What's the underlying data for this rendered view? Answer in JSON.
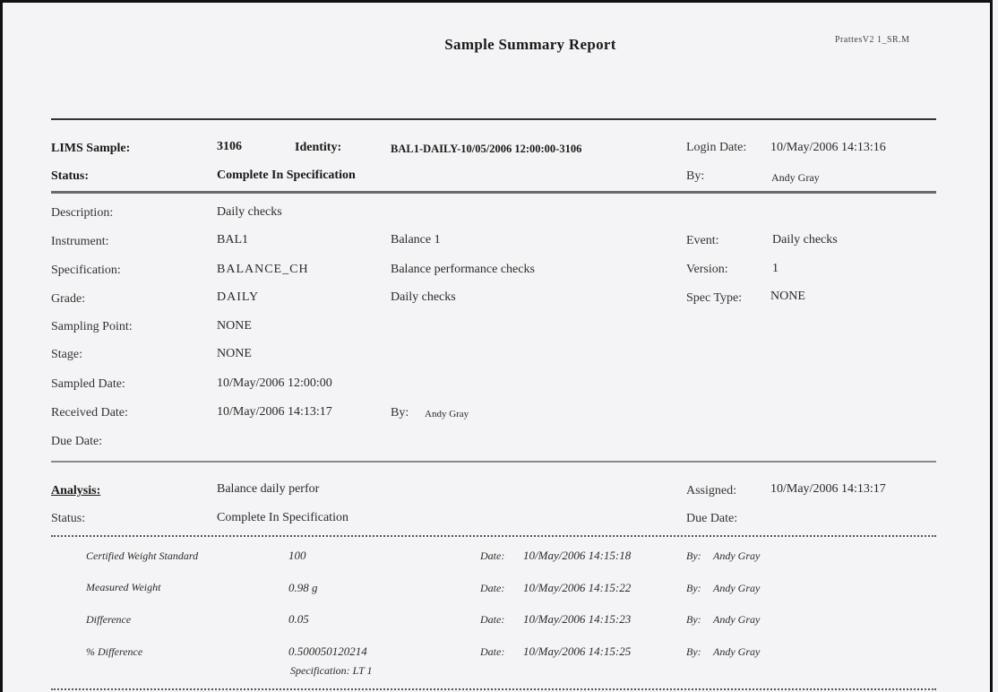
{
  "report": {
    "title": "Sample Summary Report",
    "report_id": "PrattesV2 1_SR.M"
  },
  "sample_header": {
    "lims_sample_label": "LIMS Sample:",
    "lims_sample_value": "3106",
    "identity_label": "Identity:",
    "identity_value": "BAL1-DAILY-10/05/2006 12:00:00-3106",
    "login_date_label": "Login Date:",
    "login_date_value": "10/May/2006 14:13:16",
    "status_label": "Status:",
    "status_value": "Complete In Specification",
    "by_label": "By:",
    "by_value": "Andy Gray"
  },
  "details": {
    "description_label": "Description:",
    "description_value": "Daily checks",
    "instrument_label": "Instrument:",
    "instrument_value": "BAL1",
    "instrument_desc": "Balance 1",
    "event_label": "Event:",
    "event_value": "Daily checks",
    "specification_label": "Specification:",
    "specification_value": "BALANCE_CH",
    "specification_desc": "Balance performance checks",
    "version_label": "Version:",
    "version_value": "1",
    "grade_label": "Grade:",
    "grade_value": "DAILY",
    "grade_desc": "Daily checks",
    "spec_type_label": "Spec Type:",
    "spec_type_value": "NONE",
    "sampling_point_label": "Sampling Point:",
    "sampling_point_value": "NONE",
    "stage_label": "Stage:",
    "stage_value": "NONE",
    "sampled_date_label": "Sampled Date:",
    "sampled_date_value": "10/May/2006 12:00:00",
    "received_date_label": "Received Date:",
    "received_date_value": "10/May/2006 14:13:17",
    "received_by_label": "By:",
    "received_by_value": "Andy Gray",
    "due_date_label": "Due Date:",
    "due_date_value": ""
  },
  "analysis": {
    "label": "Analysis:",
    "value": "Balance daily perfor",
    "assigned_label": "Assigned:",
    "assigned_value": "10/May/2006 14:13:17",
    "status_label": "Status:",
    "status_value": "Complete In Specification",
    "due_date_label": "Due Date:",
    "due_date_value": ""
  },
  "results": [
    {
      "name": "Certified Weight Standard",
      "value": "100",
      "date_label": "Date:",
      "date": "10/May/2006 14:15:18",
      "by_label": "By:",
      "by": "Andy Gray"
    },
    {
      "name": "Measured Weight",
      "value": "0.98 g",
      "date_label": "Date:",
      "date": "10/May/2006 14:15:22",
      "by_label": "By:",
      "by": "Andy Gray"
    },
    {
      "name": "Difference",
      "value": "0.05",
      "date_label": "Date:",
      "date": "10/May/2006 14:15:23",
      "by_label": "By:",
      "by": "Andy Gray"
    },
    {
      "name": "% Difference",
      "value": "0.500050120214",
      "date_label": "Date:",
      "date": "10/May/2006 14:15:25",
      "by_label": "By:",
      "by": "Andy Gray",
      "note": "Specification: LT 1"
    }
  ]
}
